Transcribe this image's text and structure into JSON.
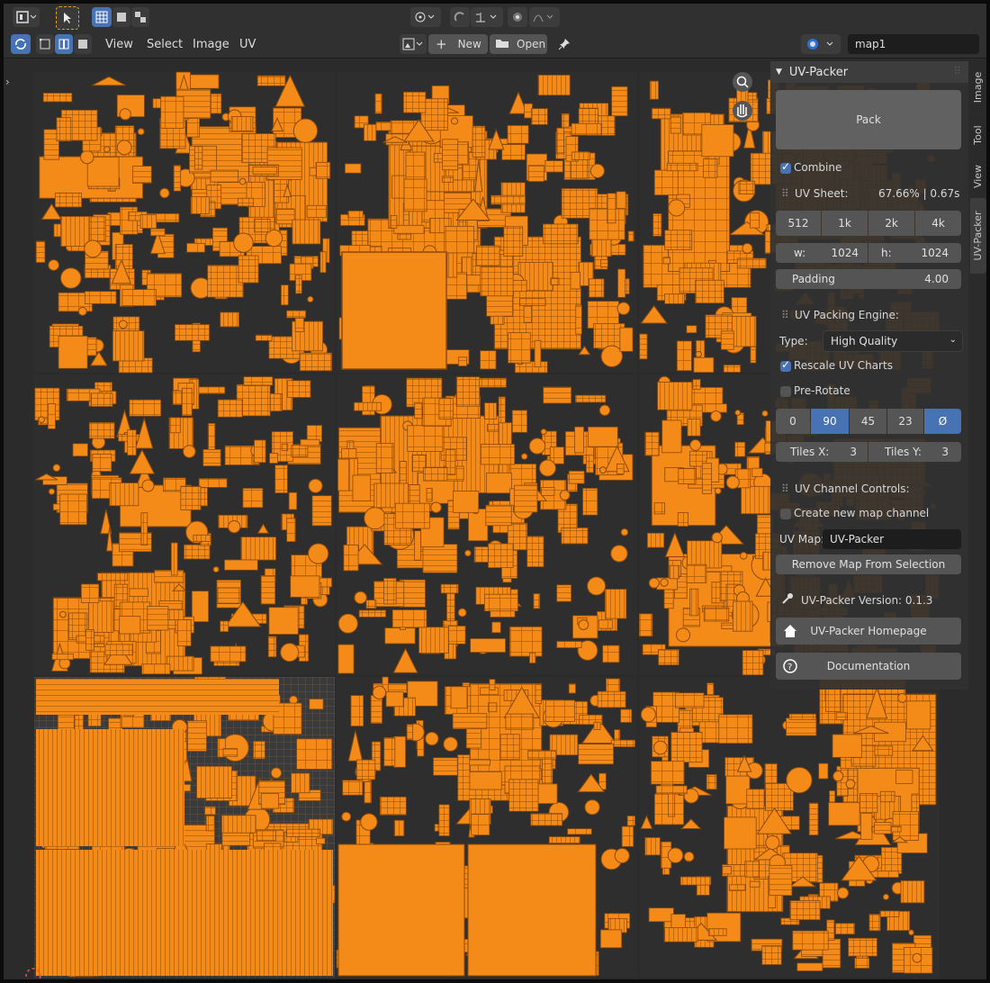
{
  "header": {
    "menus": [
      "View",
      "Select",
      "Image",
      "UV"
    ],
    "new_label": "New",
    "open_label": "Open",
    "map_name": "map1"
  },
  "panel": {
    "title": "UV-Packer",
    "pack_label": "Pack",
    "combine_label": "Combine",
    "uv_sheet_label": "UV Sheet:",
    "uv_sheet_stats": "67.66% | 0.67s",
    "sizes": [
      "512",
      "1k",
      "2k",
      "4k"
    ],
    "w_label": "w:",
    "w_value": "1024",
    "h_label": "h:",
    "h_value": "1024",
    "padding_label": "Padding",
    "padding_value": "4.00",
    "engine_label": "UV Packing Engine:",
    "type_label": "Type:",
    "type_value": "High Quality",
    "rescale_label": "Rescale UV Charts",
    "prerotate_label": "Pre-Rotate",
    "rotations": [
      "0",
      "90",
      "45",
      "23",
      "Ø"
    ],
    "tiles_x_label": "Tiles X:",
    "tiles_x_value": "3",
    "tiles_y_label": "Tiles Y:",
    "tiles_y_value": "3",
    "channel_label": "UV Channel Controls:",
    "create_channel_label": "Create new map channel",
    "uv_map_label": "UV Map:",
    "uv_map_value": "UV-Packer",
    "remove_label": "Remove Map From Selection",
    "version_label": "UV-Packer Version: 0.1.3",
    "homepage_label": "UV-Packer Homepage",
    "docs_label": "Documentation"
  },
  "side_tabs": [
    "Image",
    "Tool",
    "View",
    "UV-Packer"
  ],
  "colors": {
    "accent": "#4772b3",
    "uv_fill": "#f48a17",
    "uv_line": "#8b4a0b",
    "panel": "#303030"
  }
}
